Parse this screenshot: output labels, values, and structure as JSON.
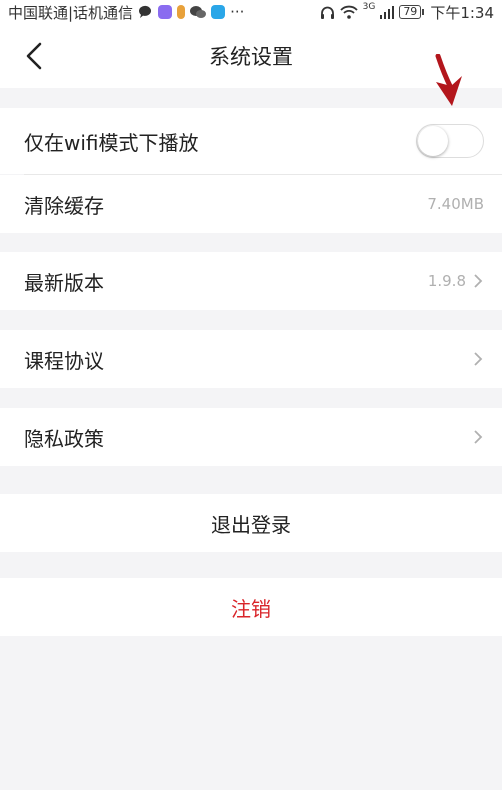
{
  "status_bar": {
    "carrier": "中国联通|话机通信",
    "more": "···",
    "network": "3G",
    "battery": "79",
    "time": "下午1:34"
  },
  "header": {
    "title": "系统设置"
  },
  "settings": {
    "wifi_only": {
      "label": "仅在wifi模式下播放",
      "enabled": false
    },
    "clear_cache": {
      "label": "清除缓存",
      "value": "7.40MB"
    },
    "latest_version": {
      "label": "最新版本",
      "value": "1.9.8"
    },
    "course_agreement": {
      "label": "课程协议"
    },
    "privacy_policy": {
      "label": "隐私政策"
    }
  },
  "actions": {
    "logout": "退出登录",
    "deregister": "注销"
  },
  "colors": {
    "accent_red": "#d9252a",
    "arrow_red": "#b3161c",
    "background": "#f4f4f6"
  }
}
